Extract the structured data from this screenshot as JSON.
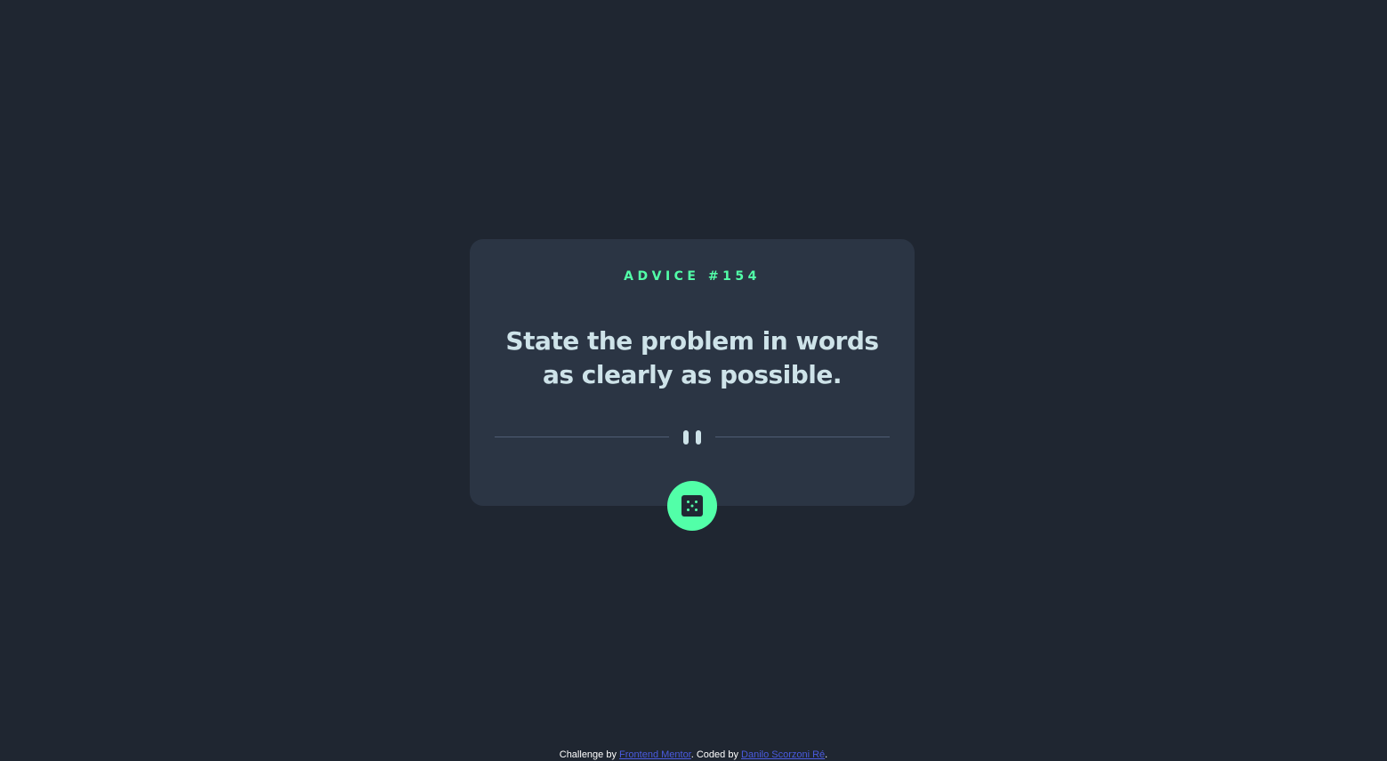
{
  "card": {
    "advice_id": "ADVICE #154",
    "advice_text": "State the problem in words as clearly as possible."
  },
  "dice_button": {
    "icon": "dice-icon",
    "aria_label": "Generate new advice"
  },
  "divider": {
    "icon": "pause-icon"
  },
  "footer": {
    "prefix": "Challenge by ",
    "link1": "Frontend Mentor",
    "middle": ". Coded by ",
    "link2": "Danilo Scorzoni Ré",
    "suffix": "."
  },
  "colors": {
    "background": "#1f2631",
    "card": "#2b3544",
    "accent": "#52ffa8",
    "text": "#cee3e9",
    "divider": "#4f5d74",
    "link": "#4a5be0"
  }
}
